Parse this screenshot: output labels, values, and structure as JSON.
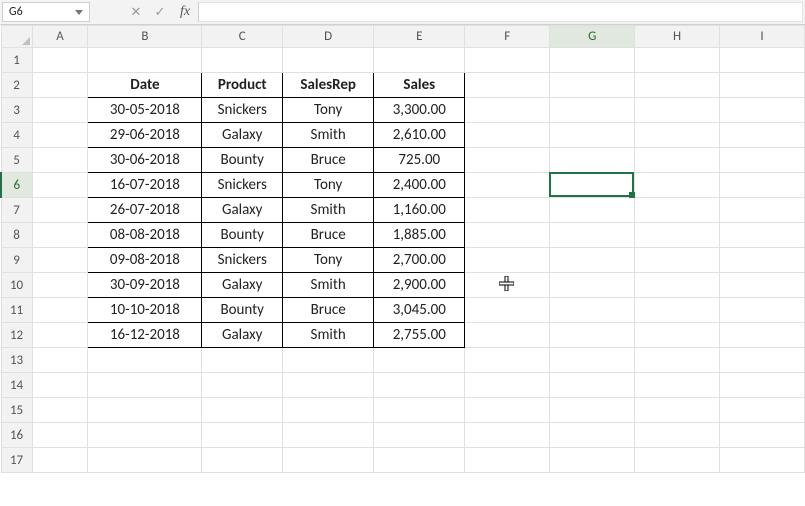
{
  "formula_bar": {
    "cell_reference": "G6",
    "cancel_glyph": "✕",
    "confirm_glyph": "✓",
    "fx_label": "fx",
    "formula_value": ""
  },
  "active_cell": "G6",
  "columns": [
    "A",
    "B",
    "C",
    "D",
    "E",
    "F",
    "G",
    "H",
    "I"
  ],
  "row_count": 17,
  "table": {
    "headers": {
      "date": "Date",
      "product": "Product",
      "salesrep": "SalesRep",
      "sales": "Sales"
    },
    "rows": [
      {
        "date": "30-05-2018",
        "product": "Snickers",
        "salesrep": "Tony",
        "sales": "3,300.00"
      },
      {
        "date": "29-06-2018",
        "product": "Galaxy",
        "salesrep": "Smith",
        "sales": "2,610.00"
      },
      {
        "date": "30-06-2018",
        "product": "Bounty",
        "salesrep": "Bruce",
        "sales": "725.00"
      },
      {
        "date": "16-07-2018",
        "product": "Snickers",
        "salesrep": "Tony",
        "sales": "2,400.00"
      },
      {
        "date": "26-07-2018",
        "product": "Galaxy",
        "salesrep": "Smith",
        "sales": "1,160.00"
      },
      {
        "date": "08-08-2018",
        "product": "Bounty",
        "salesrep": "Bruce",
        "sales": "1,885.00"
      },
      {
        "date": "09-08-2018",
        "product": "Snickers",
        "salesrep": "Tony",
        "sales": "2,700.00"
      },
      {
        "date": "30-09-2018",
        "product": "Galaxy",
        "salesrep": "Smith",
        "sales": "2,900.00"
      },
      {
        "date": "10-10-2018",
        "product": "Bounty",
        "salesrep": "Bruce",
        "sales": "3,045.00"
      },
      {
        "date": "16-12-2018",
        "product": "Galaxy",
        "salesrep": "Smith",
        "sales": "2,755.00"
      }
    ]
  },
  "cursor": {
    "visible": true,
    "near_cell": "F10"
  }
}
